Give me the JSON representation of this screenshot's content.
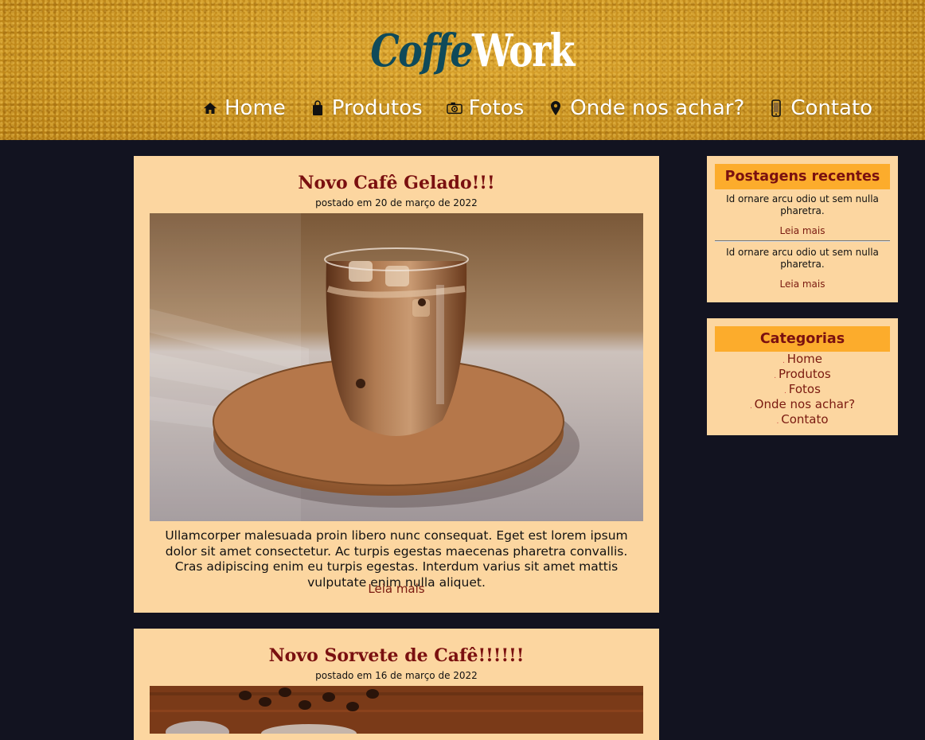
{
  "header": {
    "logo_part1": "Coffe",
    "logo_part2": "Work",
    "nav": [
      {
        "label": "Home",
        "icon": "home-icon"
      },
      {
        "label": "Produtos",
        "icon": "shopping-bag-icon"
      },
      {
        "label": "Fotos",
        "icon": "camera-icon"
      },
      {
        "label": "Onde nos achar?",
        "icon": "location-pin-icon"
      },
      {
        "label": "Contato",
        "icon": "phone-icon"
      }
    ]
  },
  "posts": [
    {
      "title": "Novo Cafê Gelado!!!",
      "date": "postado em 20 de março de 2022",
      "image": "iced-coffee-photo",
      "text": "Ullamcorper malesuada proin libero nunc consequat. Eget est lorem ipsum dolor sit amet consectetur. Ac turpis egestas maecenas pharetra convallis. Cras adipiscing enim eu turpis egestas. Interdum varius sit amet mattis vulputate enim nulla aliquet.",
      "read_more": "Leia mais"
    },
    {
      "title": "Novo Sorvete de Cafê!!!!!!",
      "date": "postado em 16 de março de 2022",
      "image": "coffee-beans-photo"
    }
  ],
  "sidebar": {
    "recent": {
      "heading": "Postagens recentes",
      "items": [
        {
          "text": "Id ornare arcu odio ut sem nulla pharetra.",
          "link": "Leia mais"
        },
        {
          "text": "Id ornare arcu odio ut sem nulla pharetra.",
          "link": "Leia mais"
        }
      ]
    },
    "categories": {
      "heading": "Categorias",
      "items": [
        "Home",
        "Produtos",
        "Fotos",
        "Onde nos achar?",
        "Contato"
      ]
    }
  },
  "colors": {
    "page_bg": "#121320",
    "card_bg": "#fcd6a0",
    "heading_bar": "#fcac2c",
    "title_color": "#7a1010",
    "logo_blue": "#0f4a5a"
  }
}
